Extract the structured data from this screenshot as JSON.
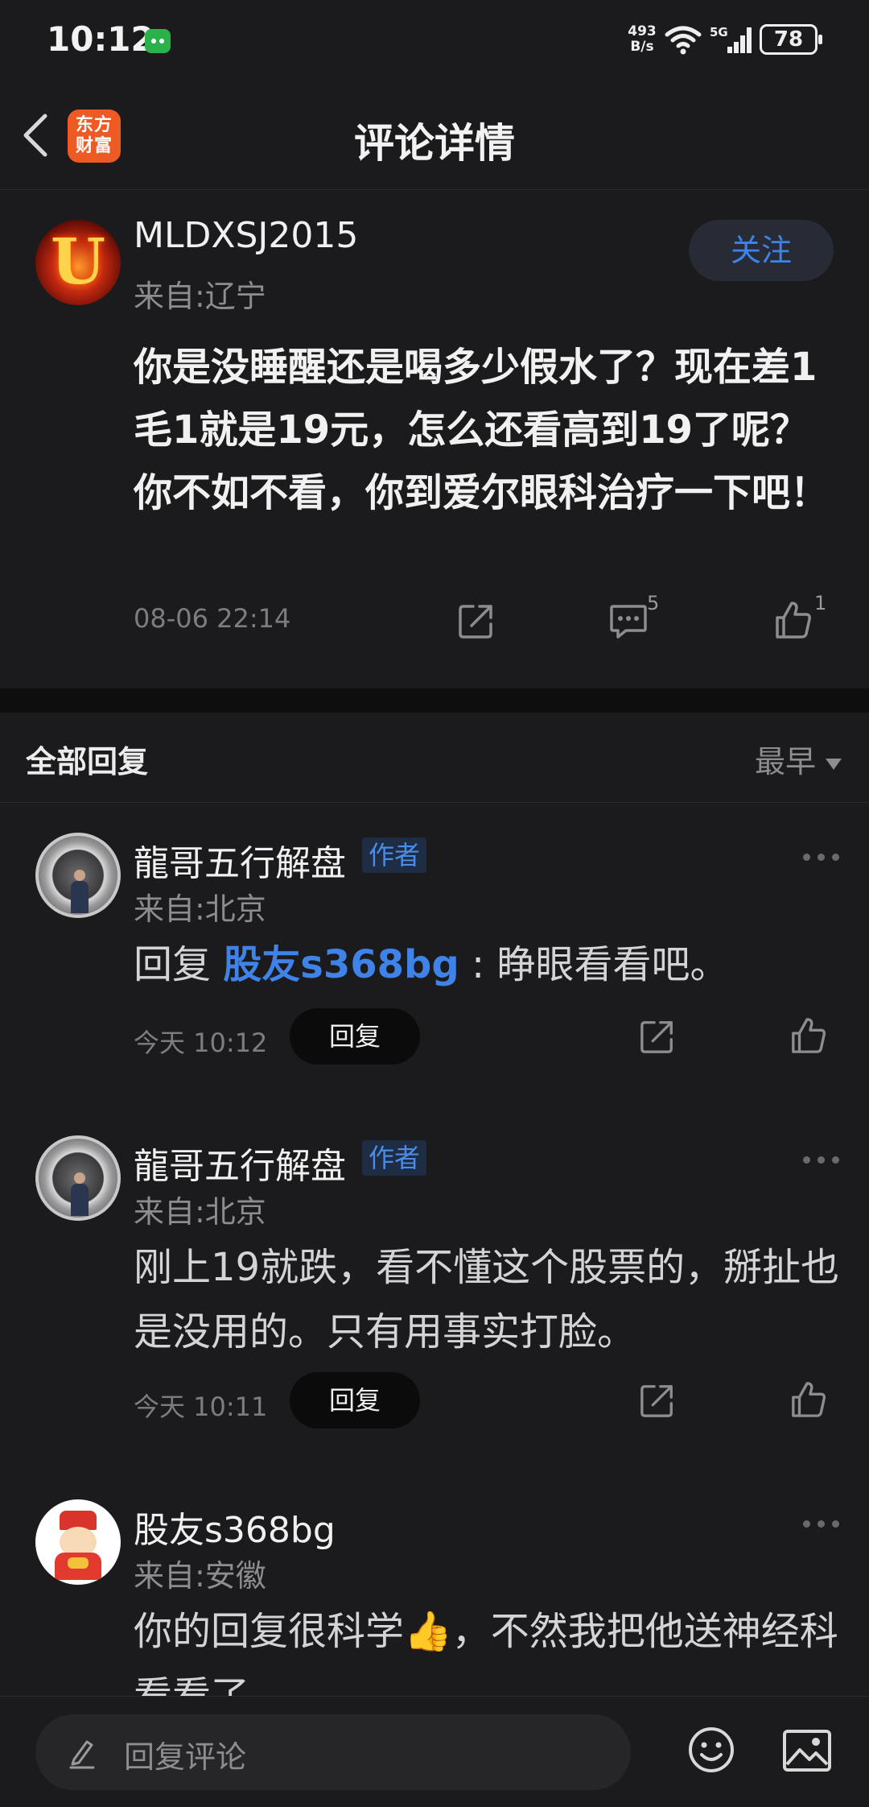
{
  "status_bar": {
    "time": "10:12",
    "net_speed_value": "493",
    "net_speed_unit": "B/s",
    "network_type": "5G",
    "battery": "78",
    "icons": [
      "wechat-icon",
      "wifi-icon",
      "signal-icon",
      "battery-icon"
    ]
  },
  "header": {
    "title": "评论详情",
    "logo_line1": "东方",
    "logo_line2": "财富",
    "logo_color": "#ee5a23"
  },
  "post": {
    "username": "MLDXSJ2015",
    "location": "来自:辽宁",
    "follow_label": "关注",
    "content": "你是没睡醒还是喝多少假水了？现在差1毛1就是19元，怎么还看高到19了呢？你不如不看，你到爱尔眼科治疗一下吧！",
    "time": "08-06 22:14",
    "comment_count": "5",
    "like_count": "1"
  },
  "replies_header": {
    "title": "全部回复",
    "sort": "最早"
  },
  "replies": [
    {
      "username": "龍哥五行解盘",
      "badge": "作者",
      "location": "来自:北京",
      "prefix": "回复 ",
      "mention": "股友s368bg",
      "text": " : 睁眼看看吧。",
      "time": "今天 10:12",
      "reply_label": "回复"
    },
    {
      "username": "龍哥五行解盘",
      "badge": "作者",
      "location": "来自:北京",
      "text": "刚上19就跌，看不懂这个股票的，掰扯也是没用的。只有用事实打脸。",
      "time": "今天 10:11",
      "reply_label": "回复"
    },
    {
      "username": "股友s368bg",
      "location": "来自:安徽",
      "text_before_emoji": "你的回复很科学",
      "emoji": "👍",
      "text_after_emoji": "，不然我把他送神经科看看了"
    }
  ],
  "bottom_bar": {
    "placeholder": "回复评论"
  },
  "colors": {
    "background": "#1b1b1d",
    "accent_blue": "#3f83e8",
    "muted_text": "#8d8d8f"
  }
}
